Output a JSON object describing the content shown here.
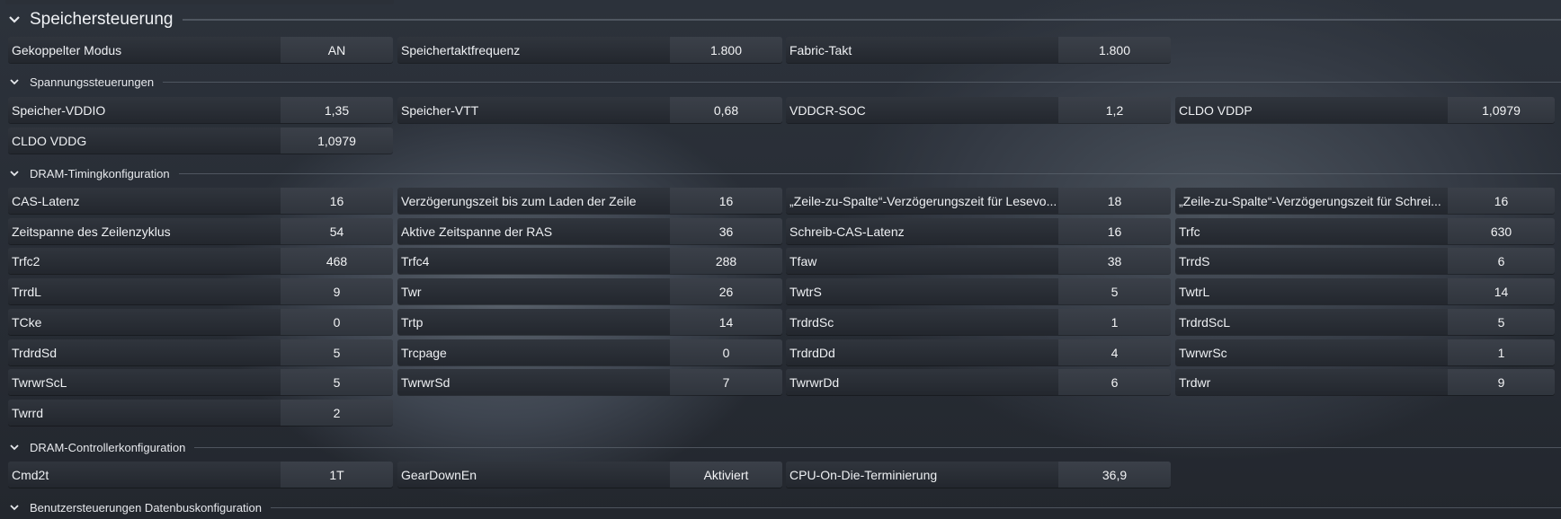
{
  "sections": {
    "memory_control": "Speichersteuerung",
    "voltage_control": "Spannungssteuerungen",
    "dram_timing": "DRAM-Timingkonfiguration",
    "dram_controller": "DRAM-Controllerkonfiguration",
    "user_data_bus": "Benutzersteuerungen Datenbuskonfiguration"
  },
  "memory_control": [
    {
      "label": "Gekoppelter Modus",
      "value": "AN"
    },
    {
      "label": "Speichertaktfrequenz",
      "value": "1.800"
    },
    {
      "label": "Fabric-Takt",
      "value": "1.800"
    }
  ],
  "voltages": [
    {
      "label": "Speicher-VDDIO",
      "value": "1,35"
    },
    {
      "label": "Speicher-VTT",
      "value": "0,68"
    },
    {
      "label": "VDDCR-SOC",
      "value": "1,2"
    },
    {
      "label": "CLDO VDDP",
      "value": "1,0979"
    },
    {
      "label": "CLDO VDDG",
      "value": "1,0979"
    }
  ],
  "timings": [
    {
      "label": "CAS-Latenz",
      "value": "16"
    },
    {
      "label": "Verzögerungszeit bis zum Laden der Zeile",
      "value": "16"
    },
    {
      "label": "„Zeile-zu-Spalte“-Verzögerungszeit für Lesevo...",
      "value": "18"
    },
    {
      "label": "„Zeile-zu-Spalte“-Verzögerungszeit für Schrei...",
      "value": "16"
    },
    {
      "label": "Zeitspanne des Zeilenzyklus",
      "value": "54"
    },
    {
      "label": "Aktive Zeitspanne der RAS",
      "value": "36"
    },
    {
      "label": "Schreib-CAS-Latenz",
      "value": "16"
    },
    {
      "label": "Trfc",
      "value": "630"
    },
    {
      "label": "Trfc2",
      "value": "468"
    },
    {
      "label": "Trfc4",
      "value": "288"
    },
    {
      "label": "Tfaw",
      "value": "38"
    },
    {
      "label": "TrrdS",
      "value": "6"
    },
    {
      "label": "TrrdL",
      "value": "9"
    },
    {
      "label": "Twr",
      "value": "26"
    },
    {
      "label": "TwtrS",
      "value": "5"
    },
    {
      "label": "TwtrL",
      "value": "14"
    },
    {
      "label": "TCke",
      "value": "0"
    },
    {
      "label": "Trtp",
      "value": "14"
    },
    {
      "label": "TrdrdSc",
      "value": "1"
    },
    {
      "label": "TrdrdScL",
      "value": "5"
    },
    {
      "label": "TrdrdSd",
      "value": "5"
    },
    {
      "label": "Trcpage",
      "value": "0"
    },
    {
      "label": "TrdrdDd",
      "value": "4"
    },
    {
      "label": "TwrwrSc",
      "value": "1"
    },
    {
      "label": "TwrwrScL",
      "value": "5"
    },
    {
      "label": "TwrwrSd",
      "value": "7"
    },
    {
      "label": "TwrwrDd",
      "value": "6"
    },
    {
      "label": "Trdwr",
      "value": "9"
    },
    {
      "label": "Twrrd",
      "value": "2"
    }
  ],
  "controller": [
    {
      "label": "Cmd2t",
      "value": "1T"
    },
    {
      "label": "GearDownEn",
      "value": "Aktiviert"
    },
    {
      "label": "CPU-On-Die-Terminierung",
      "value": "36,9"
    }
  ]
}
